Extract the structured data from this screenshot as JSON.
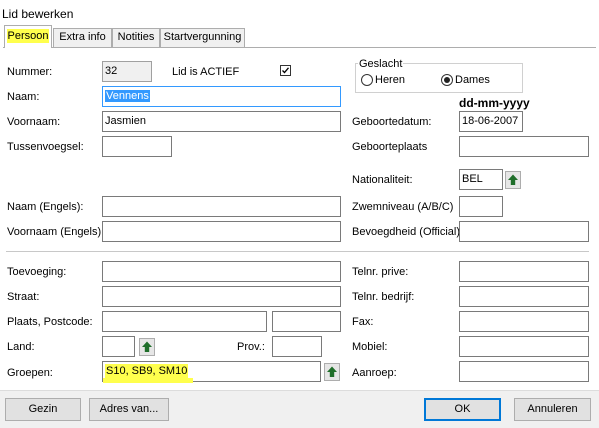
{
  "window": {
    "title": "Lid bewerken"
  },
  "tabs": [
    {
      "label": "Persoon",
      "active": true
    },
    {
      "label": "Extra info",
      "active": false
    },
    {
      "label": "Notities",
      "active": false
    },
    {
      "label": "Startvergunning",
      "active": false
    }
  ],
  "left": {
    "nummer_label": "Nummer:",
    "nummer_value": "32",
    "lid_actief_label": "Lid is ACTIEF",
    "lid_actief_checked": true,
    "naam_label": "Naam:",
    "naam_value": "Vennens",
    "voornaam_label": "Voornaam:",
    "voornaam_value": "Jasmien",
    "tussenvoegsel_label": "Tussenvoegsel:",
    "tussenvoegsel_value": "",
    "naam_engels_label": "Naam (Engels):",
    "naam_engels_value": "",
    "voornaam_engels_label": "Voornaam (Engels):",
    "voornaam_engels_value": "",
    "toevoeging_label": "Toevoeging:",
    "toevoeging_value": "",
    "straat_label": "Straat:",
    "straat_value": "",
    "plaats_label": "Plaats, Postcode:",
    "plaats_value": "",
    "postcode_value": "",
    "land_label": "Land:",
    "land_value": "",
    "prov_label": "Prov.:",
    "prov_value": "",
    "groepen_label": "Groepen:",
    "groepen_value": "S10, SB9, SM10"
  },
  "right": {
    "geslacht_label": "Geslacht",
    "heren_label": "Heren",
    "dames_label": "Dames",
    "geslacht_selected": "Dames",
    "date_format": "dd-mm-yyyy",
    "geboortedatum_label": "Geboortedatum:",
    "geboortedatum_value": "18-06-2007",
    "geboorteplaats_label": "Geboorteplaats",
    "geboorteplaats_value": "",
    "nationaliteit_label": "Nationaliteit:",
    "nationaliteit_value": "BEL",
    "zwemniveau_label": "Zwemniveau (A/B/C)",
    "zwemniveau_value": "",
    "bevoegdheid_label": "Bevoegdheid (Official)",
    "bevoegdheid_value": "",
    "telnr_prive_label": "Telnr. prive:",
    "telnr_prive_value": "",
    "telnr_bedrijf_label": "Telnr. bedrijf:",
    "telnr_bedrijf_value": "",
    "fax_label": "Fax:",
    "fax_value": "",
    "mobiel_label": "Mobiel:",
    "mobiel_value": "",
    "aanroep_label": "Aanroep:",
    "aanroep_value": ""
  },
  "buttons": {
    "gezin": "Gezin",
    "adres_van": "Adres van...",
    "ok": "OK",
    "annuleren": "Annuleren"
  },
  "colors": {
    "highlight": "#ffff4d",
    "selection": "#3399ff",
    "default_button_border": "#0078d7",
    "arrow_green": "#1f6e2a"
  }
}
